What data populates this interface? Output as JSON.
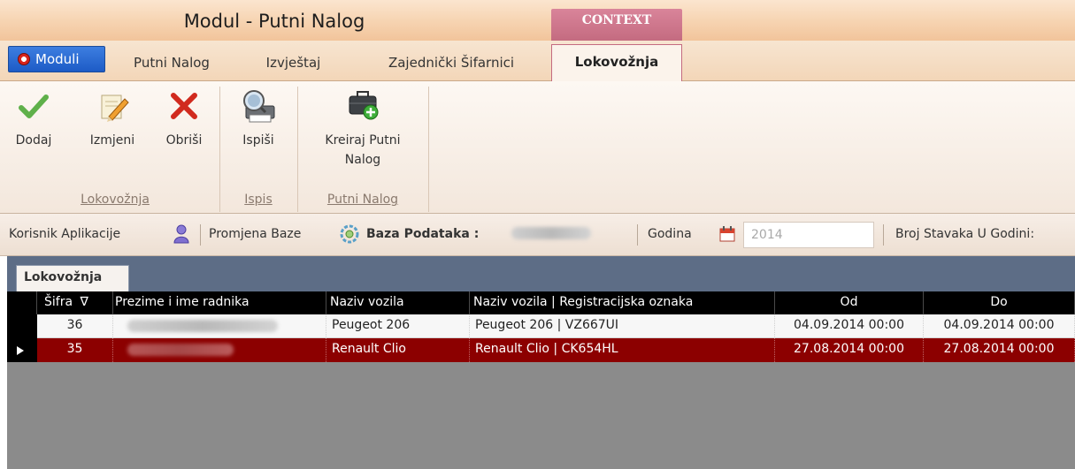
{
  "window": {
    "title": "Modul - Putni Nalog",
    "context_label": "CONTEXT"
  },
  "tabs": [
    {
      "label": "Moduli"
    },
    {
      "label": "Putni Nalog"
    },
    {
      "label": "Izvještaj"
    },
    {
      "label": "Zajednički Šifarnici"
    },
    {
      "label": "Lokovožnja"
    }
  ],
  "ribbon": {
    "buttons": {
      "dodaj": "Dodaj",
      "izmjeni": "Izmjeni",
      "obrisi": "Obriši",
      "ispisi": "Ispiši",
      "kreiraj_line1": "Kreiraj Putni",
      "kreiraj_line2": "Nalog"
    },
    "groups": {
      "lokovoznja": "Lokovožnja",
      "ispis": "Ispis",
      "putni_nalog": "Putni Nalog"
    }
  },
  "status": {
    "korisnik": "Korisnik Aplikacije",
    "promjena_baze": "Promjena Baze",
    "baza_label": "Baza Podataka :",
    "godina_label": "Godina",
    "godina_value": "2014",
    "broj_stavaka": "Broj Stavaka U Godini:"
  },
  "document": {
    "tab_label": "Lokovožnja"
  },
  "grid": {
    "columns": [
      "Šifra",
      "Prezime i ime radnika",
      "Naziv vozila",
      "Naziv vozila | Registracijska oznaka",
      "Od",
      "Do"
    ],
    "sort_glyph": "∇",
    "rows": [
      {
        "sifra": "36",
        "vozilo": "Peugeot 206",
        "vozilo_reg": "Peugeot 206 | VZ667UI",
        "od": "04.09.2014 00:00",
        "do": "04.09.2014 00:00"
      },
      {
        "sifra": "35",
        "vozilo": "Renault Clio",
        "vozilo_reg": "Renault Clio | CK654HL",
        "od": "27.08.2014 00:00",
        "do": "27.08.2014 00:00"
      }
    ]
  },
  "colors": {
    "selected_row": "#8c0000",
    "context_accent": "#c46b80",
    "moduli_button": "#1d5bc6"
  }
}
